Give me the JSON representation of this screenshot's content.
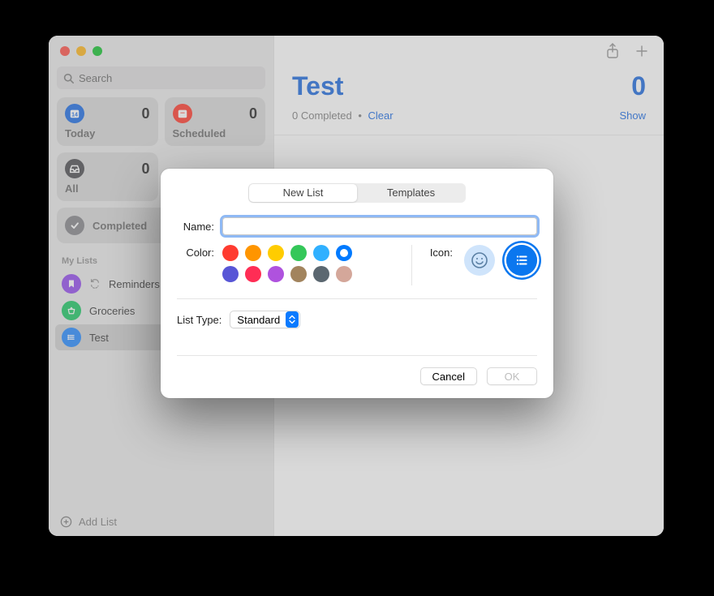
{
  "search": {
    "placeholder": "Search"
  },
  "cards": {
    "today": {
      "label": "Today",
      "count": "0",
      "icon": "calendar-icon",
      "color": "#2f78e6"
    },
    "scheduled": {
      "label": "Scheduled",
      "count": "0",
      "icon": "calendar-icon",
      "color": "#ff4a3d"
    },
    "all": {
      "label": "All",
      "count": "0",
      "icon": "tray-icon",
      "color": "#5a5a5f"
    },
    "completed": {
      "label": "Completed",
      "icon": "check-icon",
      "color": "#8f8f94"
    }
  },
  "sidebar": {
    "section": "My Lists",
    "items": [
      {
        "label": "Reminders",
        "color": "#9b59ef",
        "icon": "bookmark-icon",
        "syncing": true
      },
      {
        "label": "Groceries",
        "color": "#2ecc71",
        "icon": "basket-icon"
      },
      {
        "label": "Test",
        "color": "#3793ff",
        "icon": "list-icon",
        "selected": true
      }
    ],
    "addList": "Add List"
  },
  "main": {
    "title": "Test",
    "count": "0",
    "completedText": "0 Completed",
    "dot": "•",
    "clear": "Clear",
    "show": "Show"
  },
  "dialog": {
    "tabs": {
      "newList": "New List",
      "templates": "Templates"
    },
    "nameLabel": "Name:",
    "nameValue": "",
    "colorLabel": "Color:",
    "colors": [
      "#ff3b30",
      "#ff9500",
      "#ffcc00",
      "#34c759",
      "#30b0ff",
      "#007aff",
      "#5856d6",
      "#ff2d55",
      "#af52de",
      "#a2845e",
      "#5b6770",
      "#d4a79a"
    ],
    "selectedColorIndex": 5,
    "iconLabel": "Icon:",
    "listTypeLabel": "List Type:",
    "listTypeValue": "Standard",
    "cancel": "Cancel",
    "ok": "OK"
  }
}
